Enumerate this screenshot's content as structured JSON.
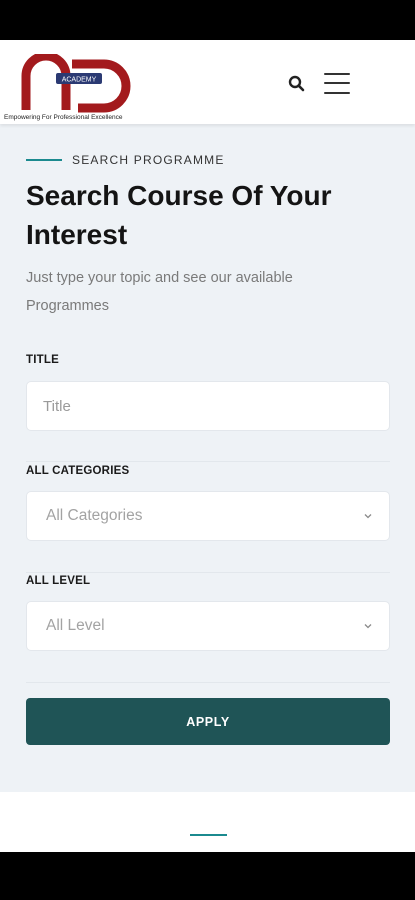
{
  "header": {
    "logo_label": "ACADEMY",
    "tagline": "Empowering For Professional Excellence",
    "icons": {
      "search": "search-icon",
      "menu": "hamburger-menu-icon"
    }
  },
  "section": {
    "eyebrow": "SEARCH PROGRAMME",
    "title": "Search Course Of Your Interest",
    "description": "Just type your topic and see our available Programmes"
  },
  "form": {
    "title_label": "TITLE",
    "title_placeholder": "Title",
    "categories_label": "ALL CATEGORIES",
    "categories_value": "All Categories",
    "level_label": "ALL LEVEL",
    "level_value": "All Level",
    "apply_label": "APPLY"
  },
  "colors": {
    "accent": "#1b8a8f",
    "button": "#1f5456",
    "logo_red": "#a31a1d",
    "logo_navy": "#2b3a73",
    "background": "#eef2f6"
  }
}
